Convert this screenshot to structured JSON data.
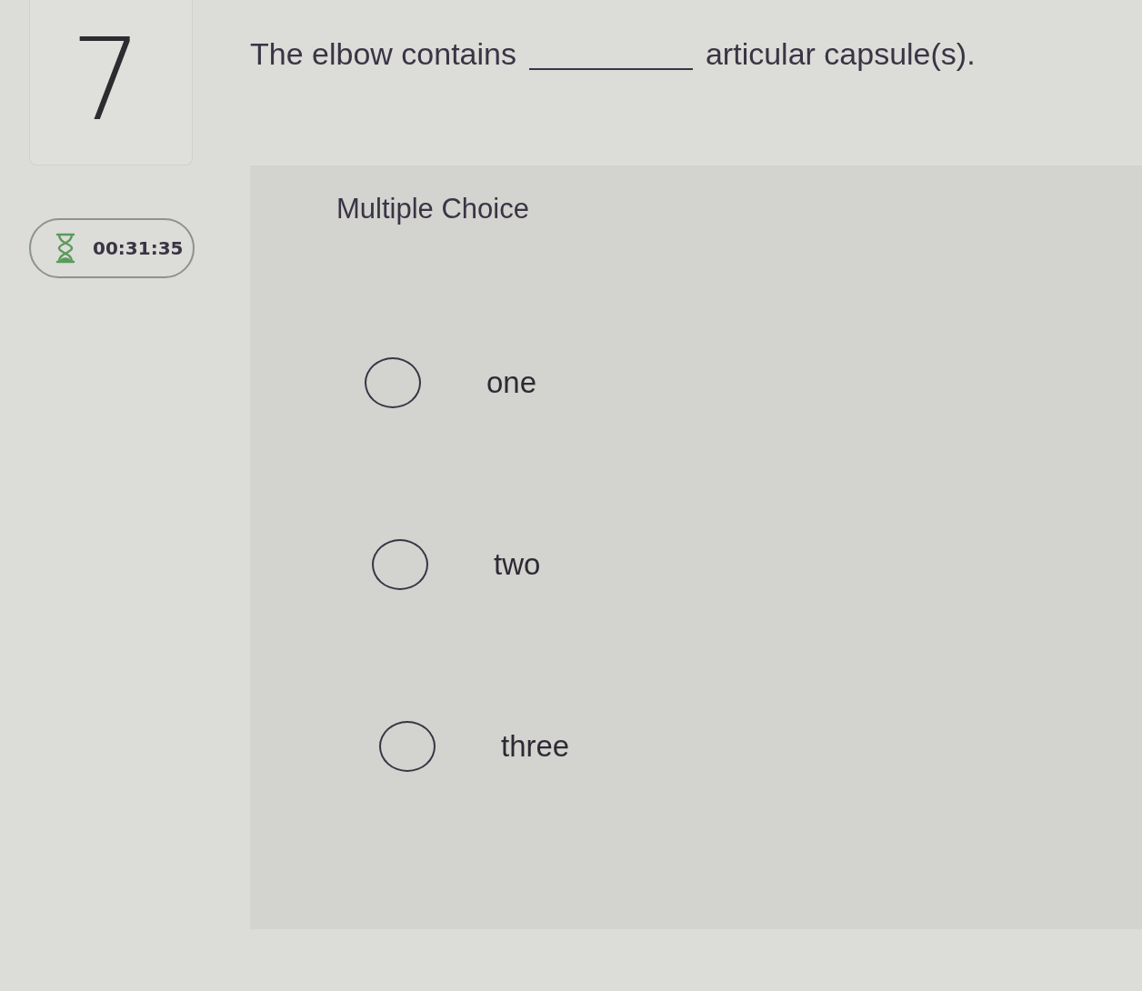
{
  "question_number": "7",
  "timer": {
    "time": "00:31:35"
  },
  "question": {
    "before": "The elbow contains",
    "after": "articular capsule(s)."
  },
  "answer_panel": {
    "type_label": "Multiple Choice",
    "options": [
      {
        "label": "one",
        "selected": false
      },
      {
        "label": "two",
        "selected": false
      },
      {
        "label": "three",
        "selected": false
      }
    ]
  }
}
